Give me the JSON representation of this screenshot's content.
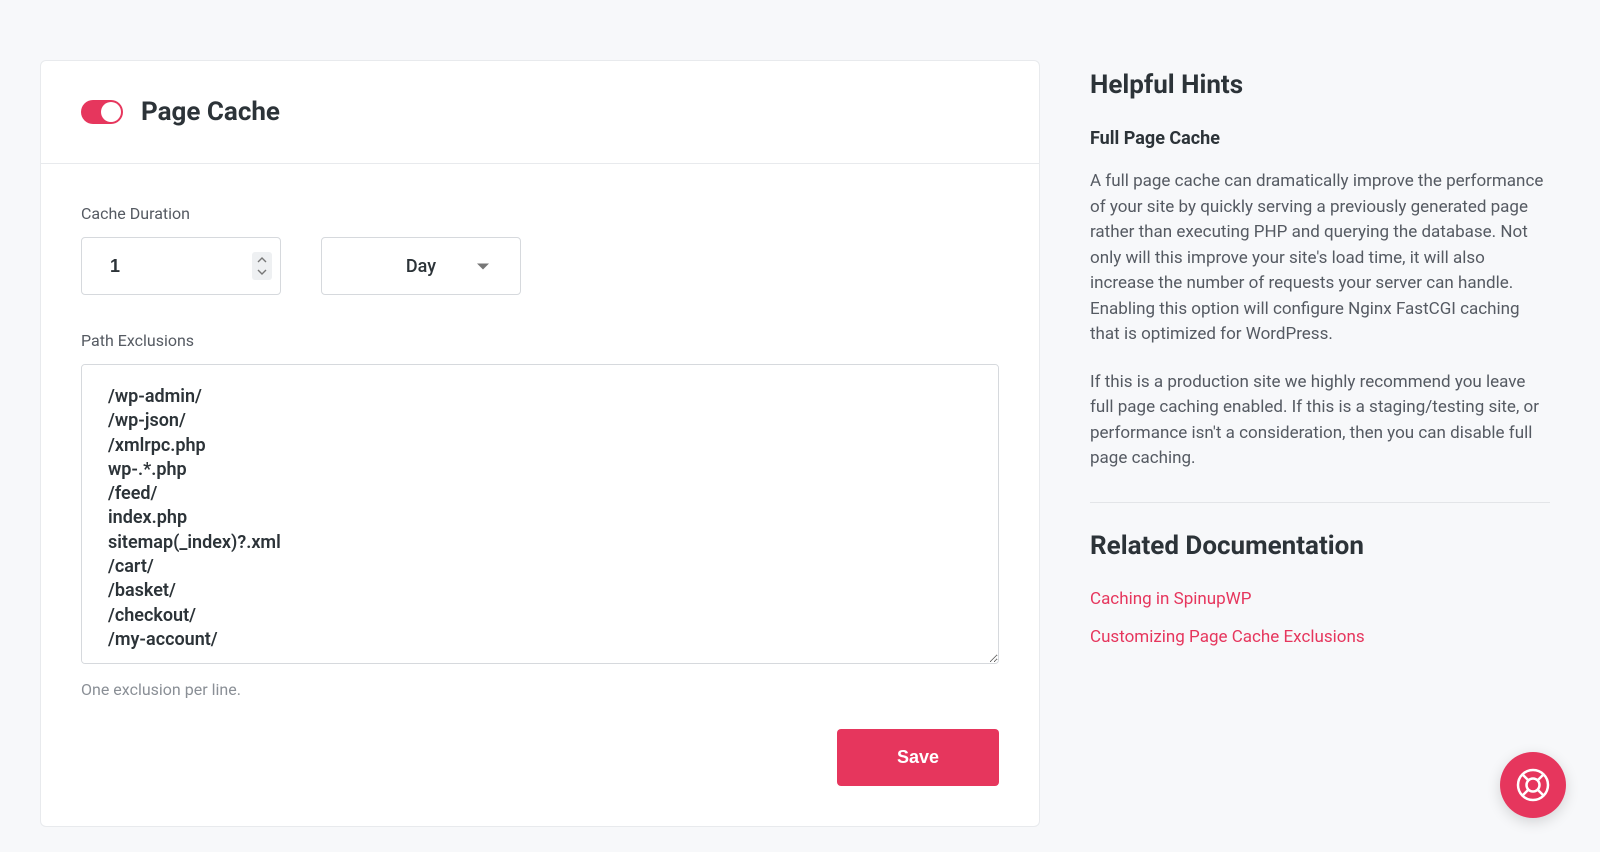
{
  "card": {
    "title": "Page Cache",
    "toggle_on": true,
    "duration_label": "Cache Duration",
    "duration_value": "1",
    "duration_unit": "Day",
    "exclusions_label": "Path Exclusions",
    "exclusions_value": "/wp-admin/\n/wp-json/\n/xmlrpc.php\nwp-.*.php\n/feed/\nindex.php\nsitemap(_index)?.xml\n/cart/\n/basket/\n/checkout/\n/my-account/",
    "exclusions_helper": "One exclusion per line.",
    "save_label": "Save"
  },
  "sidebar": {
    "hints_title": "Helpful Hints",
    "section_heading": "Full Page Cache",
    "para1": "A full page cache can dramatically improve the performance of your site by quickly serving a previously generated page rather than executing PHP and querying the database. Not only will this improve your site's load time, it will also increase the number of requests your server can handle. Enabling this option will configure Nginx FastCGI caching that is optimized for WordPress.",
    "para2": "If this is a production site we highly recommend you leave full page caching enabled. If this is a staging/testing site, or performance isn't a consideration, then you can disable full page caching.",
    "related_title": "Related Documentation",
    "links": {
      "link1": "Caching in SpinupWP",
      "link2": "Customizing Page Cache Exclusions"
    }
  },
  "colors": {
    "accent": "#e6365d"
  }
}
